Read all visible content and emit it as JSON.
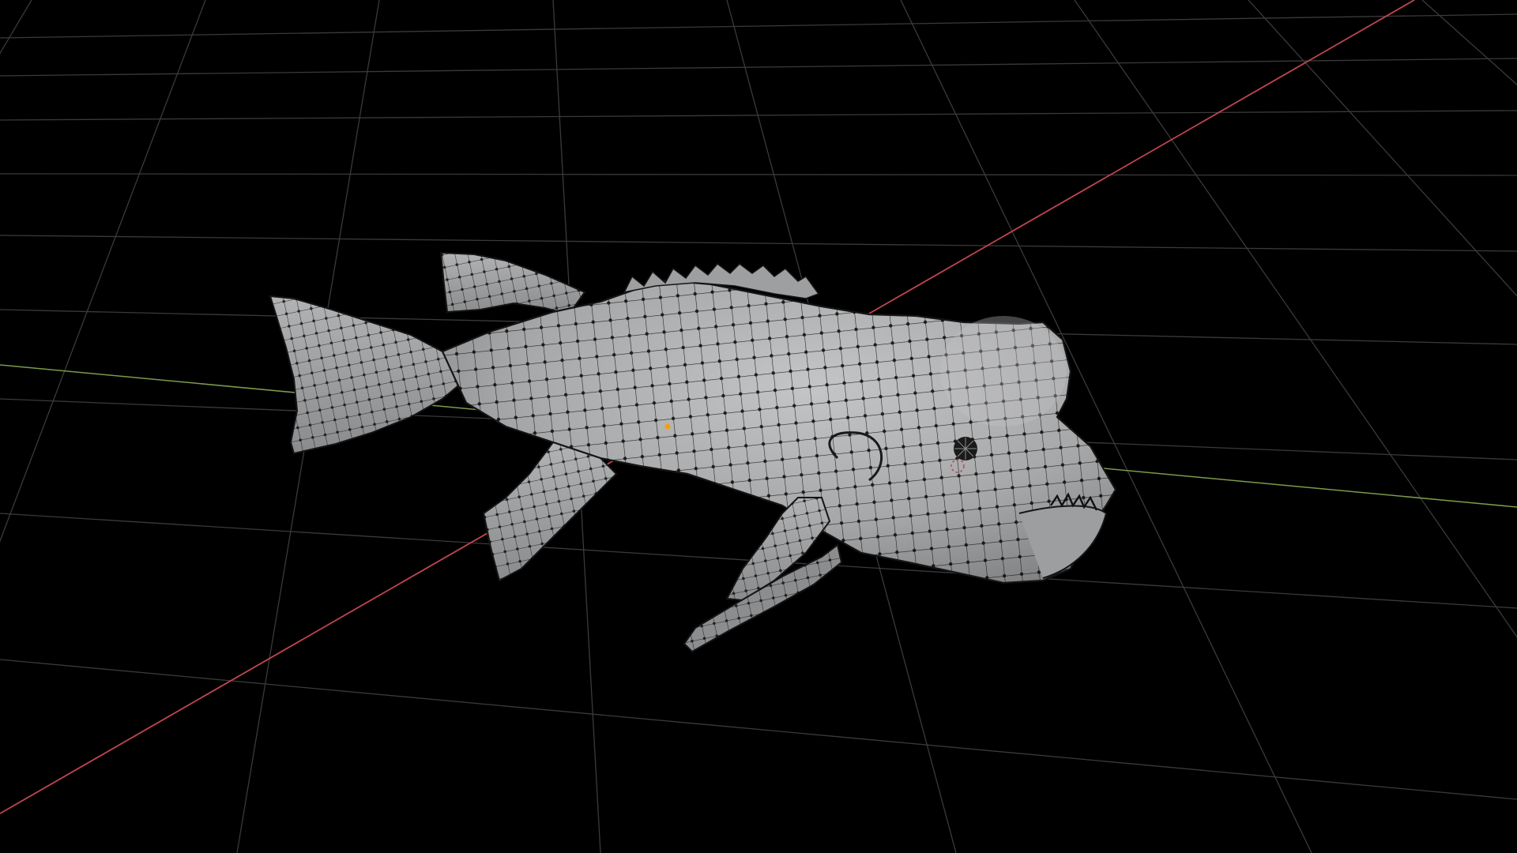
{
  "viewport": {
    "mode": "edit-mode-wireframe-overlay",
    "background_color": "#000000",
    "grid_color": "#3a3a3a",
    "x_axis_color": "#c0454f",
    "y_axis_color": "#7c9a4a",
    "mesh_color": "#a9aaab",
    "vertex_color": "#111111",
    "origin_color": "#f0a010"
  },
  "objects": [
    {
      "name": "fish-mesh",
      "selected": true
    }
  ]
}
